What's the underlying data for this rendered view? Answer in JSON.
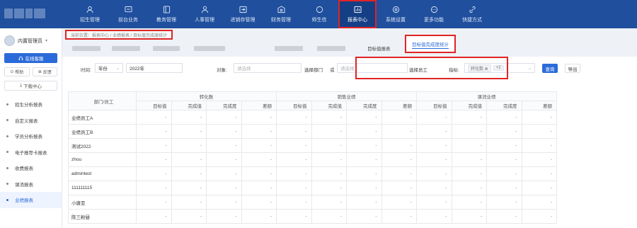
{
  "nav": [
    {
      "label": "招生管理",
      "icon": "user-add-icon"
    },
    {
      "label": "前台业务",
      "icon": "desk-icon"
    },
    {
      "label": "教务管理",
      "icon": "book-icon"
    },
    {
      "label": "人事管理",
      "icon": "person-icon"
    },
    {
      "label": "进销存管理",
      "icon": "inventory-icon"
    },
    {
      "label": "财务管理",
      "icon": "finance-icon"
    },
    {
      "label": "师生信",
      "icon": "chat-icon"
    },
    {
      "label": "报表中心",
      "icon": "report-icon",
      "active": true
    },
    {
      "label": "系统设置",
      "icon": "gear-icon"
    },
    {
      "label": "更多功能",
      "icon": "more-icon"
    },
    {
      "label": "快捷方式",
      "icon": "link-icon"
    }
  ],
  "sidebar": {
    "user": "内置管理员",
    "online": "在线客服",
    "help": "帮助",
    "feedback": "反馈",
    "download": "下载中心",
    "items": [
      {
        "label": "招生分析报表"
      },
      {
        "label": "自定义报表"
      },
      {
        "label": "学员分析报表"
      },
      {
        "label": "电子推荐卡报表"
      },
      {
        "label": "收费报表"
      },
      {
        "label": "课消报表"
      },
      {
        "label": "业绩报表",
        "active": true
      }
    ]
  },
  "breadcrumb": "当前位置：报表中心 / 业绩报表 / 目标值完成度统计",
  "tabs": {
    "target": "目标值报表",
    "completion": "目标值完成度统计"
  },
  "filters": {
    "time_label": "时间:",
    "period": "年份",
    "year": "2022年",
    "object_label": "对象:",
    "select_placeholder": "请选择",
    "select_dept": "选择部门",
    "or": "或",
    "select_staff": "选择员工",
    "metric_label": "指标:",
    "metric_tag": "转化数",
    "metric_more": "+2",
    "query": "查询",
    "export": "导出"
  },
  "table": {
    "col_header": "部门/员工",
    "groups": [
      "转化数",
      "销售业绩",
      "课消业绩"
    ],
    "sub": [
      "目标值",
      "完成值",
      "完成度",
      "差额"
    ],
    "rows": [
      {
        "name": "业绩员工A"
      },
      {
        "name": "业绩员工B"
      },
      {
        "name": "测试2022"
      },
      {
        "name": "zhou"
      },
      {
        "name": "admintest"
      },
      {
        "name": "111111115"
      },
      {
        "name": "小唐亚"
      },
      {
        "name": "陈三粉昼"
      }
    ],
    "empty": "-"
  },
  "colors": {
    "nav_bg": "#1f4f9d",
    "accent": "#2b6bd9",
    "highlight": "#e02424"
  }
}
